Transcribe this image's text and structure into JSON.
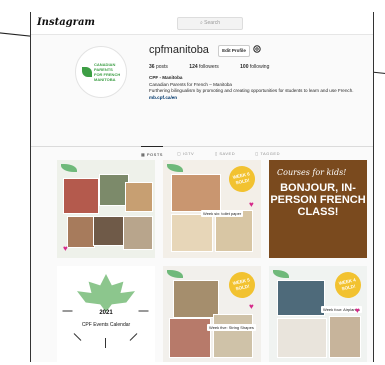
{
  "app": {
    "logo": "Instagram",
    "search_placeholder": "Search"
  },
  "profile": {
    "username": "cpfmanitoba",
    "edit_label": "Edit Profile",
    "avatar_text": "CANADIAN PARENTS FOR FRENCH MANITOBA",
    "posts_count": "36",
    "posts_label": "posts",
    "followers_count": "124",
    "followers_label": "followers",
    "following_count": "100",
    "following_label": "following",
    "name": "CPF - Manitoba",
    "bio_line1": "Canadian Parents for French – Manitoba",
    "bio_line2": "Furthering bilingualism by promoting and creating opportunities for students to learn and use French.",
    "link": "mb.cpf.ca/en"
  },
  "tabs": [
    {
      "label": "POSTS",
      "icon": "grid-icon"
    },
    {
      "label": "IGTV",
      "icon": "tv-icon"
    },
    {
      "label": "SAVED",
      "icon": "bookmark-icon"
    },
    {
      "label": "TAGGED",
      "icon": "tag-icon"
    }
  ],
  "posts": {
    "p1": {
      "badge": ""
    },
    "p2": {
      "badge": "WEEK 6 SOLD!",
      "caption": "Week six: toilet paper"
    },
    "p3": {
      "script": "Courses for kids!",
      "big": "BONJOUR, IN-PERSON FRENCH CLASS!"
    },
    "p4": {
      "year": "2021",
      "title": "CPF Events Calendar"
    },
    "p5": {
      "badge": "WEEK 5 SOLD!",
      "caption": "Week five: String Shapes"
    },
    "p6": {
      "badge": "WEEK 4 SOLD!",
      "caption": "Week four: Airplanes"
    }
  },
  "colors": {
    "brand_green": "#3d9e45",
    "badge_yellow": "#f2c230",
    "heart": "#d62a8a"
  }
}
